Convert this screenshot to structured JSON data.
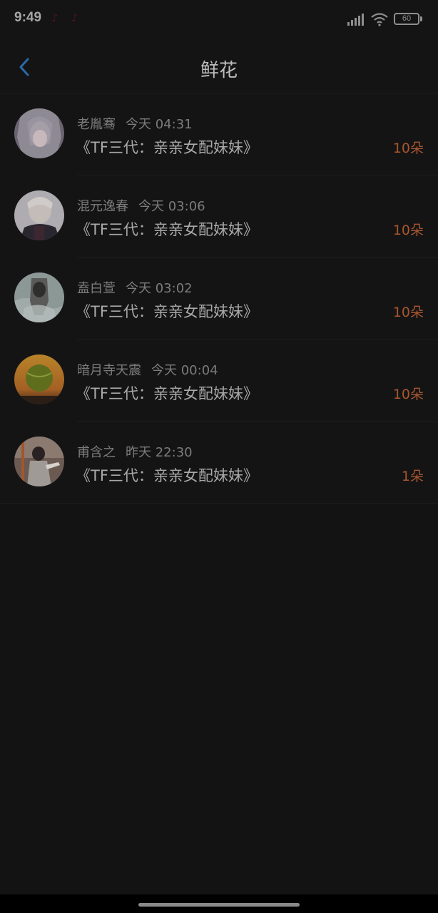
{
  "status_bar": {
    "time": "9:49",
    "battery": "60"
  },
  "header": {
    "title": "鲜花"
  },
  "items": [
    {
      "user": "老胤骞",
      "time": "今天 04:31",
      "book": "《TF三代：亲亲女配妹妹》",
      "count": "10朵"
    },
    {
      "user": "混元逸春",
      "time": "今天 03:06",
      "book": "《TF三代：亲亲女配妹妹》",
      "count": "10朵"
    },
    {
      "user": "盍白萱",
      "time": "今天 03:02",
      "book": "《TF三代：亲亲女配妹妹》",
      "count": "10朵"
    },
    {
      "user": "暗月寺天震",
      "time": "今天 00:04",
      "book": "《TF三代：亲亲女配妹妹》",
      "count": "10朵"
    },
    {
      "user": "甫含之",
      "time": "昨天 22:30",
      "book": "《TF三代：亲亲女配妹妹》",
      "count": "1朵"
    }
  ],
  "colors": {
    "background": "#131314",
    "accent_count": "#a8562e",
    "back_arrow": "#2a6aa8"
  }
}
